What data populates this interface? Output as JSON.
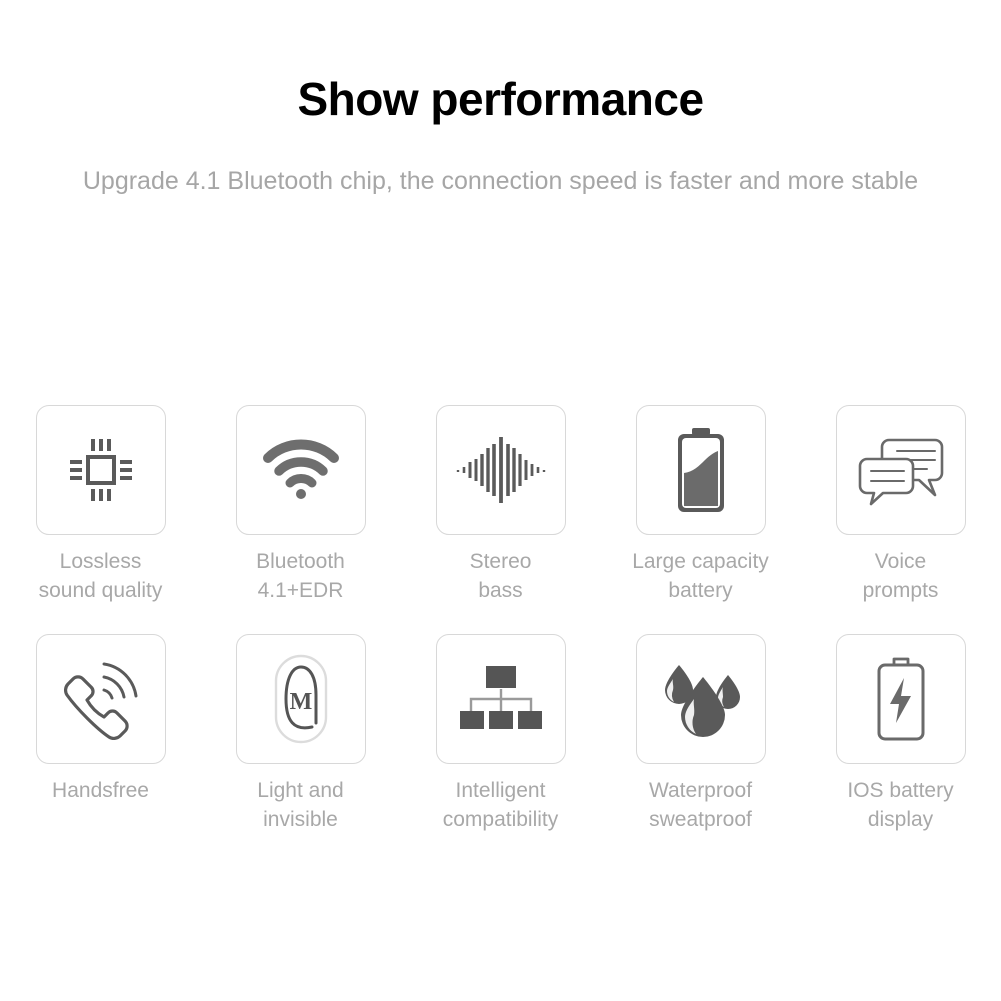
{
  "header": {
    "title": "Show performance",
    "subtitle": "Upgrade 4.1 Bluetooth chip, the connection speed is faster and more stable"
  },
  "colors": {
    "background": "#ffffff",
    "title": "#000000",
    "subtitle": "#a6a6a6",
    "label": "#a8a8a8",
    "tile_border": "#d8d8d8",
    "icon_stroke": "#5a5a5a",
    "icon_fill": "#5a5a5a",
    "icon_light": "#d5d5d5"
  },
  "features": {
    "rows": [
      [
        {
          "icon": "chip-icon",
          "label": "Lossless\nsound quality"
        },
        {
          "icon": "bluetooth-wifi-signal-icon",
          "label": "Bluetooth\n4.1+EDR"
        },
        {
          "icon": "audio-waveform-icon",
          "label": "Stereo\nbass"
        },
        {
          "icon": "battery-filled-icon",
          "label": "Large capacity\nbattery"
        },
        {
          "icon": "speech-bubbles-icon",
          "label": "Voice\nprompts"
        }
      ],
      [
        {
          "icon": "phone-handset-icon",
          "label": "Handsfree"
        },
        {
          "icon": "earbud-m-icon",
          "label": "Light and\ninvisible"
        },
        {
          "icon": "hierarchy-tree-icon",
          "label": "Intelligent\ncompatibility"
        },
        {
          "icon": "water-droplets-icon",
          "label": "Waterproof\nsweatproof"
        },
        {
          "icon": "battery-bolt-icon",
          "label": "IOS battery\ndisplay"
        }
      ]
    ]
  }
}
